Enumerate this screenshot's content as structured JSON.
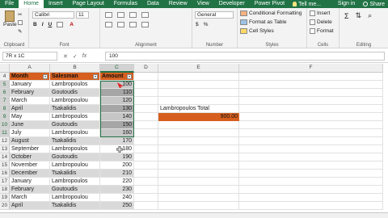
{
  "ribbon_tabs": [
    "File",
    "Home",
    "Insert",
    "Page Layout",
    "Formulas",
    "Data",
    "Review",
    "View",
    "Developer",
    "Power Pivot"
  ],
  "tell_me": "Tell me...",
  "sign_in": "Sign in",
  "share": "Share",
  "ribbon": {
    "clipboard": {
      "paste": "Paste",
      "label": "Clipboard"
    },
    "font": {
      "name": "Calibri",
      "size": "11",
      "label": "Font"
    },
    "alignment": {
      "label": "Alignment"
    },
    "number": {
      "format": "General",
      "currency": "$",
      "percent": "%",
      "label": "Number"
    },
    "styles": {
      "conditional": "Conditional Formatting",
      "format_table": "Format as Table",
      "cell_styles": "Cell Styles",
      "label": "Styles"
    },
    "cells": {
      "insert": "Insert",
      "delete": "Delete",
      "format": "Format",
      "label": "Cells"
    },
    "editing": {
      "label": "Editing"
    }
  },
  "formula_bar": {
    "name_box": "7R x 1C",
    "cancel": "✕",
    "enter": "✓",
    "fx": "fx",
    "value": "100"
  },
  "columns": [
    "A",
    "B",
    "C",
    "D",
    "E",
    "F"
  ],
  "table_headers": {
    "month": "Month",
    "salesman": "Salesman",
    "amount": "Amount"
  },
  "header_row": "4",
  "rows": [
    {
      "num": "5",
      "month": "January",
      "salesman": "Lambropoulos",
      "amount": "100"
    },
    {
      "num": "6",
      "month": "February",
      "salesman": "Goutoudis",
      "amount": "110"
    },
    {
      "num": "7",
      "month": "March",
      "salesman": "Lambropoulou",
      "amount": "120"
    },
    {
      "num": "8",
      "month": "April",
      "salesman": "Tsakalidis",
      "amount": "130"
    },
    {
      "num": "9",
      "month": "May",
      "salesman": "Lambropoulos",
      "amount": "140"
    },
    {
      "num": "10",
      "month": "June",
      "salesman": "Goutoudis",
      "amount": "150"
    },
    {
      "num": "11",
      "month": "July",
      "salesman": "Lambropoulou",
      "amount": "160"
    },
    {
      "num": "12",
      "month": "August",
      "salesman": "Tsakalidis",
      "amount": "170"
    },
    {
      "num": "13",
      "month": "September",
      "salesman": "Lambropoulos",
      "amount": "180"
    },
    {
      "num": "14",
      "month": "October",
      "salesman": "Goutoudis",
      "amount": "190"
    },
    {
      "num": "15",
      "month": "November",
      "salesman": "Lambropoulou",
      "amount": "200"
    },
    {
      "num": "16",
      "month": "December",
      "salesman": "Tsakalidis",
      "amount": "210"
    },
    {
      "num": "17",
      "month": "January",
      "salesman": "Lambropoulos",
      "amount": "220"
    },
    {
      "num": "18",
      "month": "February",
      "salesman": "Goutoudis",
      "amount": "230"
    },
    {
      "num": "19",
      "month": "March",
      "salesman": "Lambropoulou",
      "amount": "240"
    },
    {
      "num": "20",
      "month": "April",
      "salesman": "Tsakalidis",
      "amount": "250"
    }
  ],
  "total": {
    "label": "Lambropoulos Total",
    "value": "900.00"
  },
  "colors": {
    "ribbon": "#217346",
    "header_fill": "#d65f1f",
    "band": "#d9d9d9",
    "selection": "#217346"
  }
}
